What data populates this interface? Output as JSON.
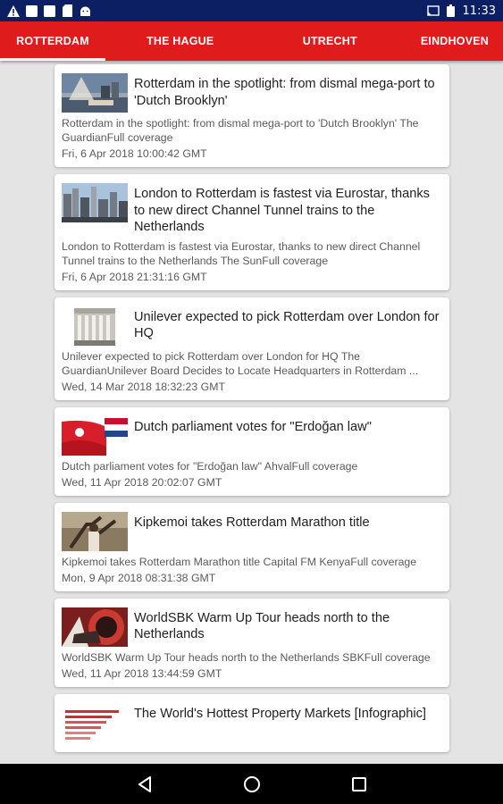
{
  "status_bar": {
    "time": "11:33",
    "left_icons": [
      "warning-icon",
      "notification-square-icon",
      "notification-square-icon",
      "sd-card-icon",
      "android-icon"
    ],
    "right_icons": [
      "cast-icon",
      "battery-icon"
    ]
  },
  "tabs": [
    {
      "label": "ROTTERDAM",
      "active": true
    },
    {
      "label": "THE HAGUE",
      "active": false
    },
    {
      "label": "UTRECHT",
      "active": false
    },
    {
      "label": "EINDHOVEN",
      "active": false
    }
  ],
  "colors": {
    "status_bar": "#0d1f63",
    "tab_bar": "#e01b1b",
    "background": "#e4e4e4"
  },
  "articles": [
    {
      "title": "Rotterdam in the spotlight: from dismal mega-port to 'Dutch Brooklyn'",
      "snippet": "Rotterdam in the spotlight: from dismal mega-port to 'Dutch Brooklyn' The GuardianFull coverage",
      "date": "Fri, 6 Apr 2018 10:00:42 GMT",
      "image": "bridge-photo"
    },
    {
      "title": "London to Rotterdam is fastest via Eurostar, thanks to new direct Channel Tunnel trains to the Netherlands",
      "snippet": "London to Rotterdam is fastest via Eurostar, thanks to new direct Channel Tunnel trains to the Netherlands  The SunFull coverage",
      "date": "Fri, 6 Apr 2018 21:31:16 GMT",
      "image": "skyline-photo"
    },
    {
      "title": "Unilever expected to pick Rotterdam over London for HQ",
      "snippet": "Unilever expected to pick Rotterdam over London for HQ  The GuardianUnilever Board Decides to Locate Headquarters in Rotterdam  ...",
      "date": "Wed, 14 Mar 2018 18:32:23 GMT",
      "image": "building-photo"
    },
    {
      "title": "Dutch parliament votes for \"Erdoğan law\"",
      "snippet": "Dutch parliament votes for \"Erdoğan law\"  AhvalFull coverage",
      "date": "Wed, 11 Apr 2018 20:02:07 GMT",
      "image": "flags-photo"
    },
    {
      "title": "Kipkemoi takes Rotterdam Marathon title",
      "snippet": "Kipkemoi takes Rotterdam Marathon title  Capital FM KenyaFull coverage",
      "date": "Mon, 9 Apr 2018 08:31:38 GMT",
      "image": "runner-photo"
    },
    {
      "title": "WorldSBK Warm Up Tour heads north to the Netherlands",
      "snippet": "WorldSBK Warm Up Tour heads north to the Netherlands  SBKFull coverage",
      "date": "Wed, 11 Apr 2018 13:44:59 GMT",
      "image": "motorbike-photo"
    },
    {
      "title": "The World's Hottest Property Markets [Infographic]",
      "snippet": "",
      "date": "",
      "image": "infographic-photo"
    }
  ]
}
